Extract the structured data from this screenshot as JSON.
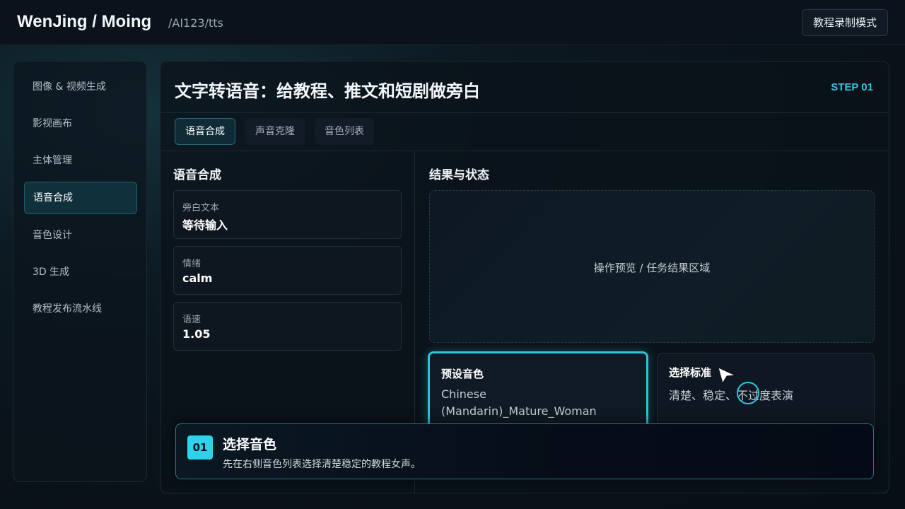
{
  "header": {
    "brand": "WenJing / Moing",
    "path": "/AI123/tts",
    "mode_button": "教程录制模式"
  },
  "sidebar": {
    "items": [
      {
        "label": "图像 & 视频生成"
      },
      {
        "label": "影视画布"
      },
      {
        "label": "主体管理"
      },
      {
        "label": "语音合成",
        "active": true
      },
      {
        "label": "音色设计"
      },
      {
        "label": "3D 生成"
      },
      {
        "label": "教程发布流水线"
      }
    ]
  },
  "main": {
    "title": "文字转语音：给教程、推文和短剧做旁白",
    "step": "STEP 01",
    "tabs": [
      {
        "label": "语音合成",
        "active": true
      },
      {
        "label": "声音克隆"
      },
      {
        "label": "音色列表"
      }
    ]
  },
  "form": {
    "title": "语音合成",
    "fields": [
      {
        "label": "旁白文本",
        "value": "等待输入"
      },
      {
        "label": "情绪",
        "value": "calm"
      },
      {
        "label": "语速",
        "value": "1.05"
      }
    ]
  },
  "result": {
    "title": "结果与状态",
    "preview_text": "操作预览 / 任务结果区域",
    "voice_card": {
      "title": "预设音色",
      "value": "Chinese (Mandarin)_Mature_Woman"
    },
    "criteria_card": {
      "title": "选择标准",
      "value": "清楚、稳定、不过度表演"
    }
  },
  "tutorial": {
    "step_number": "01",
    "title": "选择音色",
    "description": "先在右侧音色列表选择清楚稳定的教程女声。"
  },
  "colors": {
    "accent": "#2ec8e0",
    "background": "#0a121a"
  }
}
